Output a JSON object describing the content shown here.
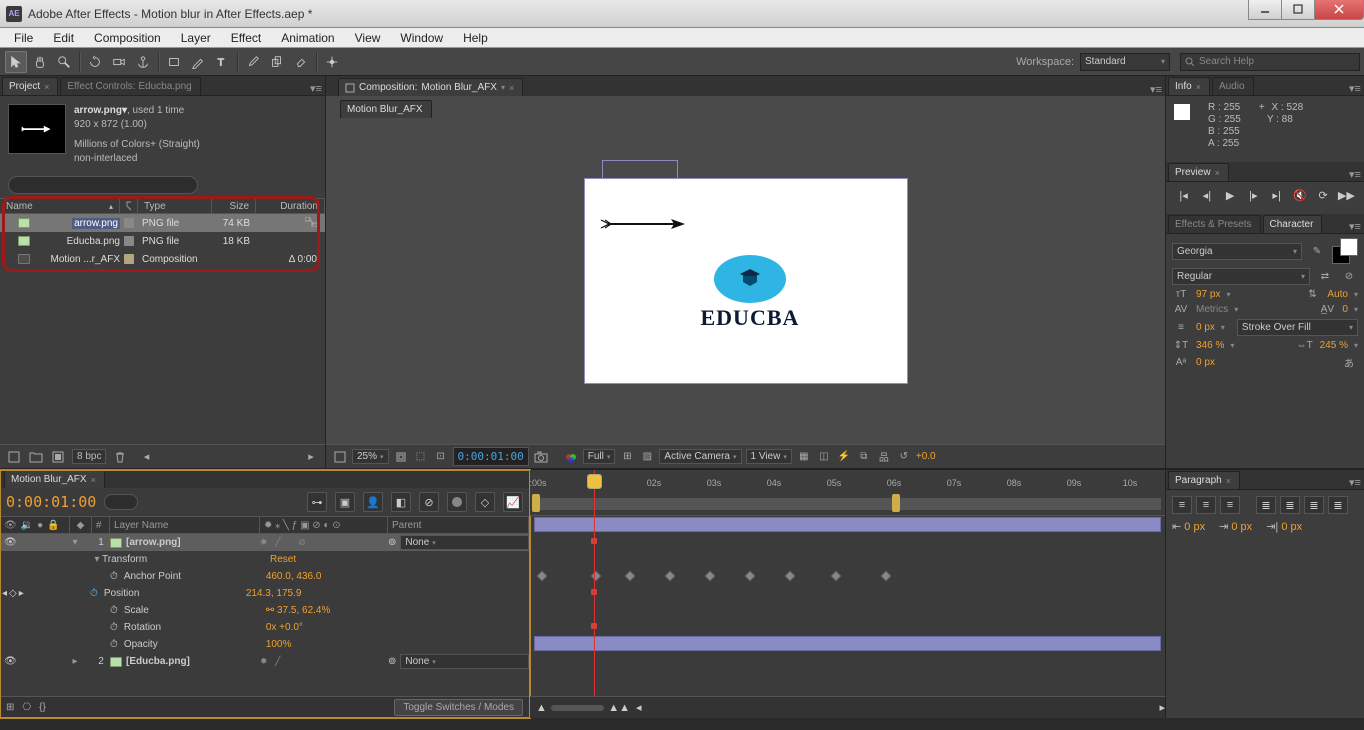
{
  "title": "Adobe After Effects - Motion blur in After Effects.aep *",
  "menu": [
    "File",
    "Edit",
    "Composition",
    "Layer",
    "Effect",
    "Animation",
    "View",
    "Window",
    "Help"
  ],
  "workspace": {
    "label": "Workspace:",
    "value": "Standard"
  },
  "search_help": "Search Help",
  "project_panel": {
    "tab": "Project",
    "tab2": "Effect Controls: Educba.png",
    "item_name": "arrow.png▾",
    "usage": ", used 1 time",
    "dims": "920 x 872 (1.00)",
    "color_line": "Millions of Colors+ (Straight)",
    "interlace": "non-interlaced",
    "columns": {
      "name": "Name",
      "type": "Type",
      "size": "Size",
      "duration": "Duration"
    },
    "rows": [
      {
        "name": "arrow.png",
        "type": "PNG file",
        "size": "74 KB",
        "dur": "",
        "sel": true,
        "kind": "img"
      },
      {
        "name": "Educba.png",
        "type": "PNG file",
        "size": "18 KB",
        "dur": "",
        "sel": false,
        "kind": "img"
      },
      {
        "name": "Motion ...r_AFX",
        "type": "Composition",
        "size": "",
        "dur": "Δ 0:00",
        "sel": false,
        "kind": "comp"
      }
    ],
    "bpc": "8 bpc"
  },
  "comp_panel": {
    "tab_prefix": "Composition: ",
    "tab_name": "Motion Blur_AFX",
    "subtab": "Motion Blur_AFX",
    "logo_text": "EDUCBA",
    "zoom": "25%",
    "timecode": "0:00:01:00",
    "ch": "Full",
    "camera": "Active Camera",
    "views": "1 View",
    "exposure": "+0.0"
  },
  "info_panel": {
    "tab": "Info",
    "tab2": "Audio",
    "r": "R : 255",
    "g": "G : 255",
    "b": "B : 255",
    "a": "A : 255",
    "x": "X : 528",
    "y": "Y : 88"
  },
  "preview_panel": {
    "tab": "Preview"
  },
  "char_panel": {
    "tab1": "Effects & Presets",
    "tab2": "Character",
    "font": "Georgia",
    "style": "Regular",
    "size": "97",
    "leading": "Auto",
    "kerning": "Metrics",
    "tracking": "0",
    "stroke_w": "0",
    "stroke_mode": "Stroke Over Fill",
    "vscale": "346",
    "hscale": "245",
    "baseline": "0"
  },
  "para_panel": {
    "tab": "Paragraph",
    "indent": "0"
  },
  "timeline": {
    "tab": "Motion Blur_AFX",
    "time": "0:00:01:00",
    "col_layer": "Layer Name",
    "col_parent": "Parent",
    "parent_none": "None",
    "layers": [
      {
        "num": "1",
        "name": "[arrow.png]",
        "sel": true
      },
      {
        "num": "2",
        "name": "[Educba.png]",
        "sel": false
      }
    ],
    "transform": "Transform",
    "reset": "Reset",
    "props": [
      {
        "name": "Anchor Point",
        "val": "460.0, 436.0"
      },
      {
        "name": "Position",
        "val": "214.3, 175.9"
      },
      {
        "name": "Scale",
        "val": "37.5, 62.4%",
        "link": true
      },
      {
        "name": "Rotation",
        "val": "0x +0.0°"
      },
      {
        "name": "Opacity",
        "val": "100%"
      }
    ],
    "toggle": "Toggle Switches / Modes",
    "ruler_labels": [
      ":00s",
      "02s",
      "03s",
      "04s",
      "05s",
      "06s",
      "07s",
      "08s",
      "09s",
      "10s"
    ]
  }
}
